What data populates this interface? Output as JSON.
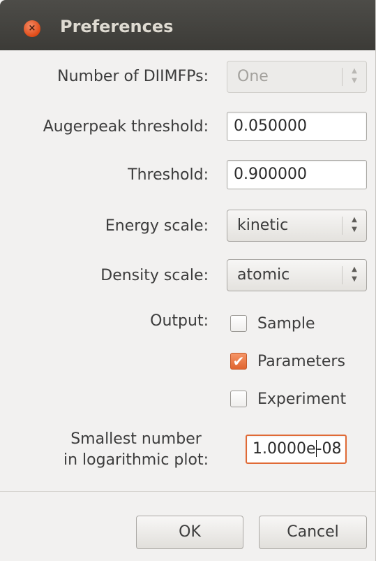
{
  "window": {
    "title": "Preferences",
    "close_glyph": "×"
  },
  "fields": {
    "diimfps_label": "Number of DIIMFPs:",
    "diimfps_value": "One",
    "augerpeak_label": "Augerpeak threshold:",
    "augerpeak_value": "0.050000",
    "threshold_label": "Threshold:",
    "threshold_value": "0.900000",
    "energy_scale_label": "Energy scale:",
    "energy_scale_value": "kinetic",
    "density_scale_label": "Density scale:",
    "density_scale_value": "atomic",
    "output_label": "Output:",
    "smallest_label_line1": "Smallest number",
    "smallest_label_line2": "in logarithmic plot:",
    "smallest_value_before_caret": "1.0000e",
    "smallest_value_after_caret": "-08"
  },
  "output_options": [
    {
      "label": "Sample",
      "checked": false
    },
    {
      "label": "Parameters",
      "checked": true
    },
    {
      "label": "Experiment",
      "checked": false
    }
  ],
  "buttons": {
    "ok": "OK",
    "cancel": "Cancel"
  },
  "icons": {
    "check_glyph": "✔",
    "spin_glyph_up": "▲",
    "spin_glyph_down": "▼"
  },
  "colors": {
    "accent": "#e06a36",
    "titlebar": "#3c3b37",
    "dialog_bg": "#f2f1f0"
  }
}
